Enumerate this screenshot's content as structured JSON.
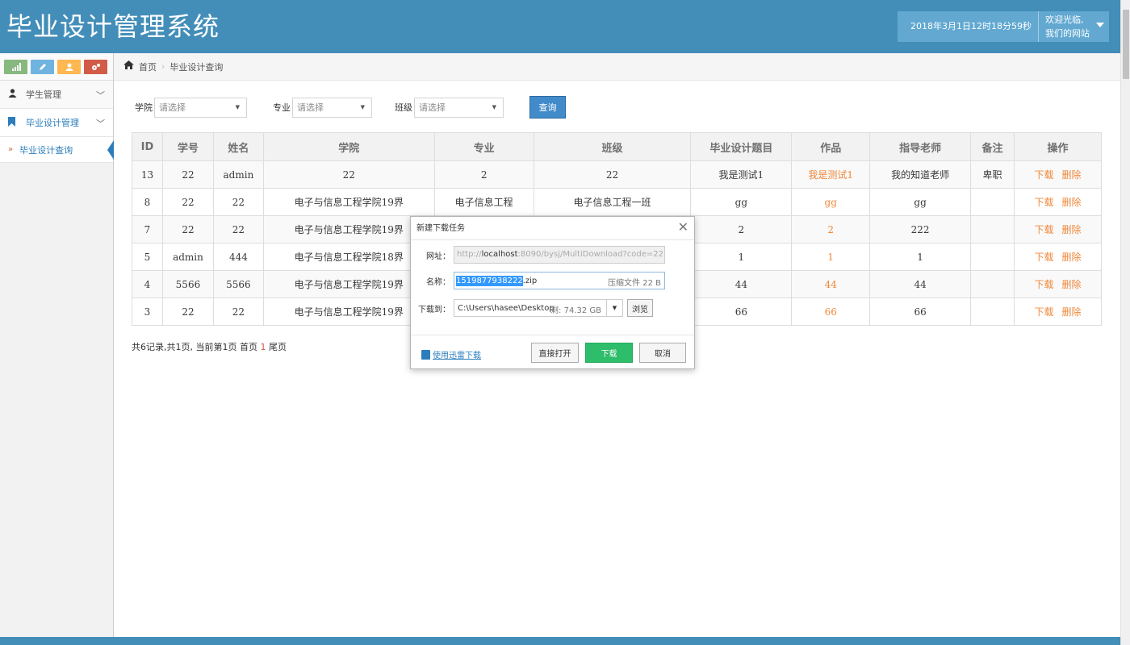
{
  "header": {
    "app_title": "毕业设计管理系统",
    "datetime": "2018年3月1日12时18分59秒",
    "welcome_line1": "欢迎光临,",
    "welcome_line2": "我们的网站"
  },
  "sidebar": {
    "items": [
      {
        "label": "学生管理"
      },
      {
        "label": "毕业设计管理"
      }
    ],
    "sub_items": [
      {
        "label": "毕业设计查询"
      }
    ]
  },
  "breadcrumb": {
    "home": "首页",
    "current": "毕业设计查询"
  },
  "filters": {
    "college_label": "学院",
    "college_value": "请选择",
    "major_label": "专业",
    "major_value": "请选择",
    "class_label": "班级",
    "class_value": "请选择",
    "query_label": "查询"
  },
  "table": {
    "headers": [
      "ID",
      "学号",
      "姓名",
      "学院",
      "专业",
      "班级",
      "毕业设计题目",
      "作品",
      "指导老师",
      "备注",
      "操作"
    ],
    "rows": [
      {
        "id": "13",
        "student_no": "22",
        "name": "admin",
        "college": "22",
        "major": "2",
        "class": "22",
        "topic": "我是测试1",
        "work": "我是测试1",
        "teacher": "我的知道老师",
        "note": "卑职"
      },
      {
        "id": "8",
        "student_no": "22",
        "name": "22",
        "college": "电子与信息工程学院19界",
        "major": "电子信息工程",
        "class": "电子信息工程一班",
        "topic": "gg",
        "work": "gg",
        "teacher": "gg",
        "note": ""
      },
      {
        "id": "7",
        "student_no": "22",
        "name": "22",
        "college": "电子与信息工程学院19界",
        "major": "",
        "class": "",
        "topic": "2",
        "work": "2",
        "teacher": "222",
        "note": ""
      },
      {
        "id": "5",
        "student_no": "admin",
        "name": "444",
        "college": "电子与信息工程学院18界",
        "major": "",
        "class": "",
        "topic": "1",
        "work": "1",
        "teacher": "1",
        "note": ""
      },
      {
        "id": "4",
        "student_no": "5566",
        "name": "5566",
        "college": "电子与信息工程学院19界",
        "major": "",
        "class": "",
        "topic": "44",
        "work": "44",
        "teacher": "44",
        "note": ""
      },
      {
        "id": "3",
        "student_no": "22",
        "name": "22",
        "college": "电子与信息工程学院19界",
        "major": "",
        "class": "",
        "topic": "66",
        "work": "66",
        "teacher": "66",
        "note": ""
      }
    ],
    "op_download": "下载",
    "op_delete": "删除"
  },
  "pager": {
    "text_before": "共6记录,共1页, 当前第1页 首页",
    "current": "1",
    "text_after": "尾页"
  },
  "dialog": {
    "title": "新建下载任务",
    "url_label": "网址：",
    "url_prefix": "http://",
    "url_host": "localhost",
    "url_rest": ":8090/bysj/MultiDownload?code=22",
    "name_label": "名称：",
    "name_selected": "1519877938222",
    "name_ext": ".zip",
    "name_meta": "压缩文件 22 B",
    "path_label": "下载到：",
    "path_value": "C:\\Users\\hasee\\Desktop",
    "path_free": "剩: 74.32 GB",
    "browse_label": "浏览",
    "xunlei_link": "使用迅雷下载",
    "btn_direct": "直接打开",
    "btn_download": "下载",
    "btn_cancel": "取消"
  },
  "colors": {
    "header_bg": "#438eb9",
    "link_orange": "#f0883a",
    "query_button": "#428bca",
    "download_button": "#2ebd6b"
  }
}
